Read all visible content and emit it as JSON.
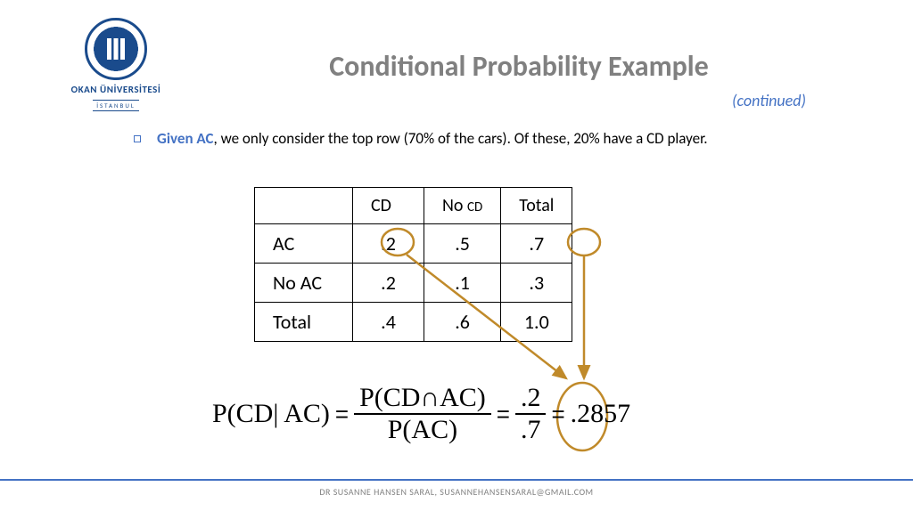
{
  "logo": {
    "name": "OKAN ÜNİVERSİTESİ",
    "sub": "İSTANBUL"
  },
  "title": "Conditional Probability Example",
  "continued": "(continued)",
  "bullet": {
    "prefix": "Given AC",
    "rest": ", we only consider the top row (70% of the cars). Of these, 20% have a CD player."
  },
  "table": {
    "headers": [
      "",
      "CD",
      "No CD",
      "Total"
    ],
    "rows": [
      {
        "label": "AC",
        "cells": [
          ".2",
          ".5",
          ".7"
        ]
      },
      {
        "label": "No AC",
        "cells": [
          ".2",
          ".1",
          ".3"
        ]
      },
      {
        "label": "Total",
        "cells": [
          ".4",
          ".6",
          "1.0"
        ]
      }
    ]
  },
  "formula": {
    "lhs": "P(CD| AC)",
    "frac1_num": "P(CD∩AC)",
    "frac1_den": "P(AC)",
    "frac2_num": ".2",
    "frac2_den": ".7",
    "result": ".2857"
  },
  "footer": "DR SUSANNE HANSEN SARAL, SUSANNEHANSENSARAL@GMAIL.COM",
  "chart_data": {
    "type": "table",
    "title": "Conditional Probability: Cars with AC and CD",
    "columns": [
      "",
      "CD",
      "No CD",
      "Total"
    ],
    "rows": [
      [
        "AC",
        0.2,
        0.5,
        0.7
      ],
      [
        "No AC",
        0.2,
        0.1,
        0.3
      ],
      [
        "Total",
        0.4,
        0.6,
        1.0
      ]
    ],
    "computation": {
      "expression": "P(CD | AC) = P(CD ∩ AC) / P(AC) = 0.2 / 0.7",
      "result": 0.2857
    }
  }
}
